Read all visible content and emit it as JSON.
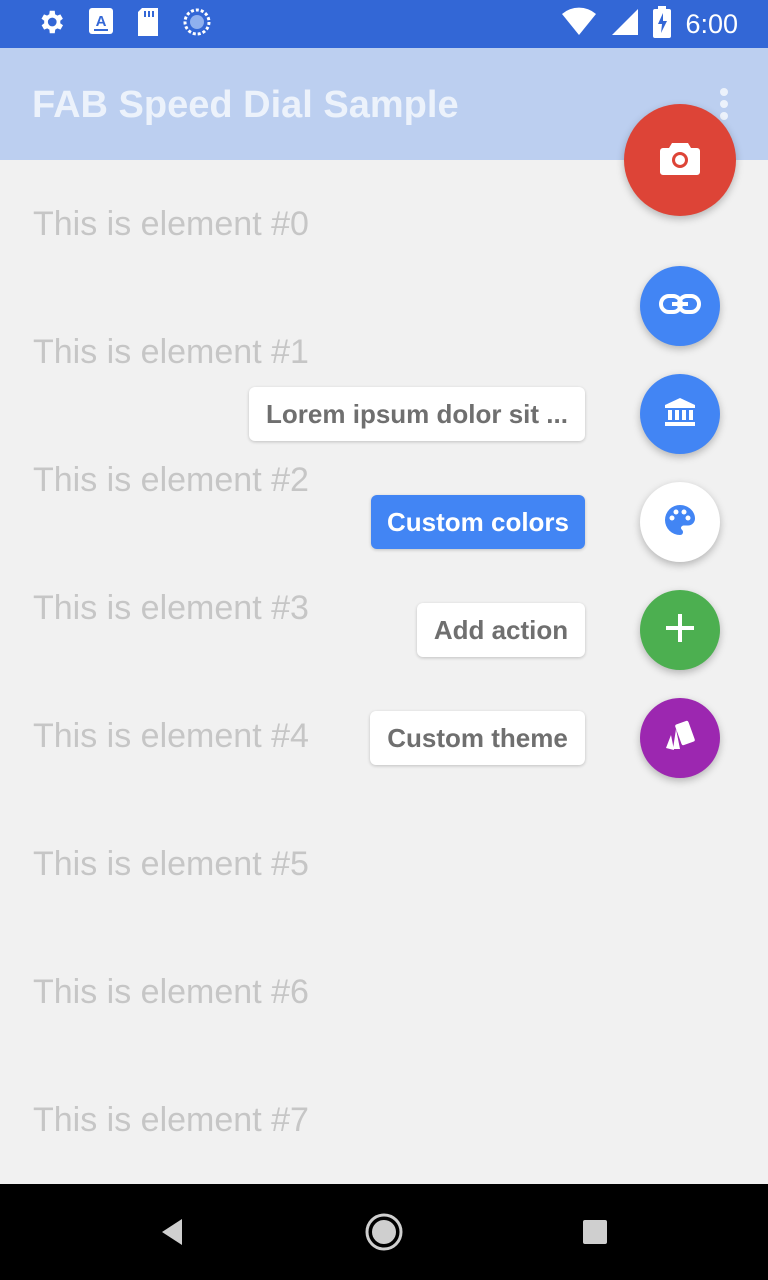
{
  "status_bar": {
    "time": "6:00",
    "left_icons": [
      "settings-icon",
      "a11y-icon",
      "sd-card-icon",
      "sync-icon"
    ],
    "right_icons": [
      "wifi-icon",
      "signal-icon",
      "battery-charging-icon"
    ]
  },
  "app_bar": {
    "title": "FAB Speed Dial Sample",
    "overflow_icon": "more-vert-icon"
  },
  "list": {
    "items": [
      "This is element #0",
      "This is element #1",
      "This is element #2",
      "This is element #3",
      "This is element #4",
      "This is element #5",
      "This is element #6",
      "This is element #7"
    ]
  },
  "speed_dial": {
    "main_icon": "camera-icon",
    "actions": [
      {
        "icon": "link-icon",
        "label": ""
      },
      {
        "icon": "bank-icon",
        "label": "Lorem ipsum dolor sit ..."
      },
      {
        "icon": "palette-icon",
        "label": "Custom colors"
      },
      {
        "icon": "add-icon",
        "label": "Add action"
      },
      {
        "icon": "cards-icon",
        "label": "Custom theme"
      }
    ]
  },
  "colors": {
    "status_bar": "#3367d6",
    "app_bar": "#bccff0",
    "fab_main": "#dd4437",
    "fab_blue": "#4285f4",
    "fab_green": "#4caf50",
    "fab_purple": "#9c27b0"
  },
  "nav_bar": {
    "icons": [
      "back-icon",
      "home-icon",
      "recents-icon"
    ]
  }
}
